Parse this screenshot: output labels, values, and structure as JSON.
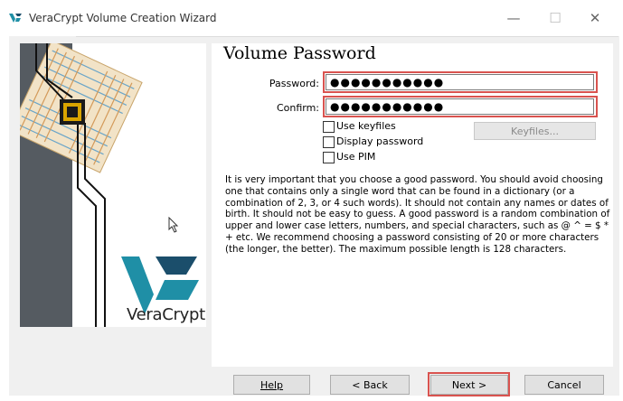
{
  "window": {
    "title": "VeraCrypt Volume Creation Wizard",
    "minimize_glyph": "—",
    "maximize_glyph": "☐",
    "close_glyph": "✕"
  },
  "page": {
    "title": "Volume Password"
  },
  "form": {
    "password_label": "Password:",
    "password_value": "●●●●●●●●●●●",
    "confirm_label": "Confirm:",
    "confirm_value": "●●●●●●●●●●●",
    "options": [
      {
        "label": "Use keyfiles",
        "checked": false
      },
      {
        "label": "Display password",
        "checked": false
      },
      {
        "label": "Use PIM",
        "checked": false
      }
    ],
    "keyfiles_button": "Keyfiles..."
  },
  "description": "It is very important that you choose a good password. You should avoid choosing one that contains only a single word that can be found in a dictionary (or a combination of 2, 3, or 4 such words). It should not contain any names or dates of birth. It should not be easy to guess. A good password is a random combination of upper and lower case letters, numbers, and special characters, such as @ ^ = $ * + etc. We recommend choosing a password consisting of 20 or more characters (the longer, the better). The maximum possible length is 128 characters.",
  "logo": {
    "text": "VeraCrypt"
  },
  "buttons": {
    "help": "Help",
    "back": "< Back",
    "next": "Next >",
    "cancel": "Cancel"
  },
  "colors": {
    "highlight": "#d9534f",
    "logo_teal": "#1f8fa6",
    "logo_dark": "#1b4e6b",
    "sidebar_dark": "#555b61"
  }
}
